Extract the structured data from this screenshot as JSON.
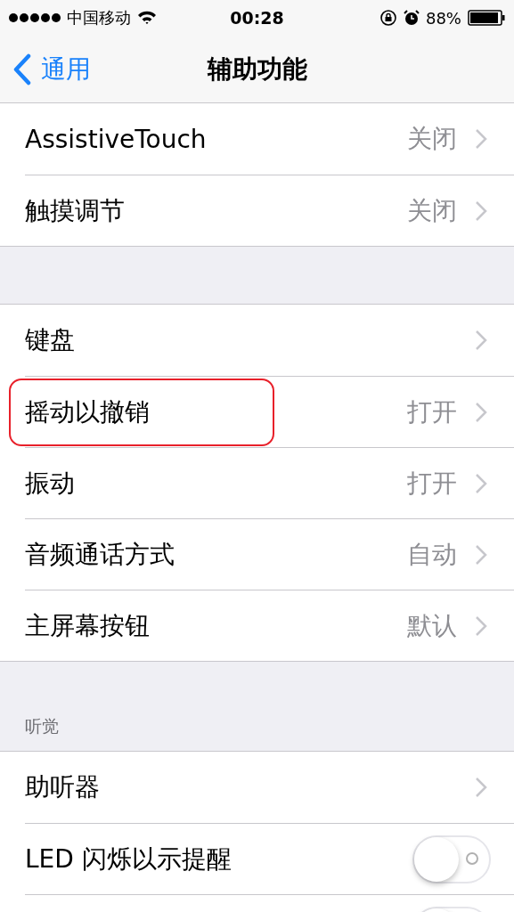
{
  "status_bar": {
    "carrier": "中国移动",
    "time": "00:28",
    "battery": "88%"
  },
  "nav": {
    "back": "通用",
    "title": "辅助功能"
  },
  "groups": [
    {
      "rows": [
        {
          "kind": "link",
          "label": "AssistiveTouch",
          "value": "关闭",
          "highlighted": false
        },
        {
          "kind": "link",
          "label": "触摸调节",
          "value": "关闭",
          "highlighted": false
        }
      ]
    },
    {
      "rows": [
        {
          "kind": "link",
          "label": "键盘",
          "highlighted": false
        },
        {
          "kind": "link",
          "label": "摇动以撤销",
          "value": "打开",
          "highlighted": true
        },
        {
          "kind": "link",
          "label": "振动",
          "value": "打开",
          "highlighted": false
        },
        {
          "kind": "link",
          "label": "音频通话方式",
          "value": "自动",
          "highlighted": false
        },
        {
          "kind": "link",
          "label": "主屏幕按钮",
          "value": "默认",
          "highlighted": false
        }
      ]
    },
    {
      "header": "听觉",
      "rows": [
        {
          "kind": "link",
          "label": "助听器",
          "highlighted": false
        },
        {
          "kind": "toggle",
          "label": "LED 闪烁以示提醒",
          "on": false,
          "highlighted": false
        },
        {
          "kind": "toggle",
          "on": false,
          "highlighted": false
        }
      ]
    }
  ]
}
